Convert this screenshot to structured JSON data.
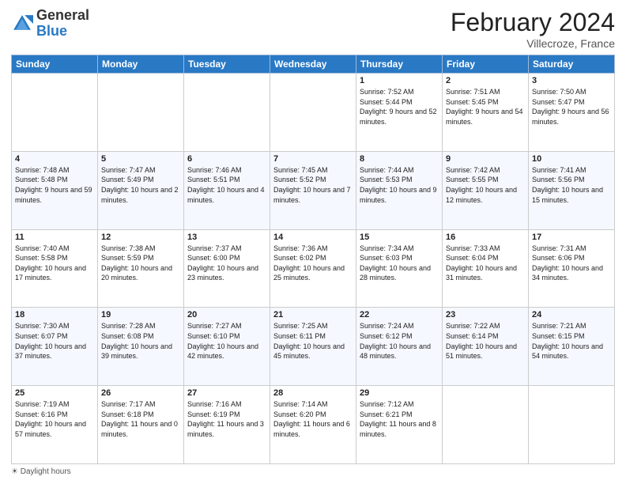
{
  "logo": {
    "general": "General",
    "blue": "Blue"
  },
  "header": {
    "title": "February 2024",
    "subtitle": "Villecroze, France"
  },
  "days": [
    "Sunday",
    "Monday",
    "Tuesday",
    "Wednesday",
    "Thursday",
    "Friday",
    "Saturday"
  ],
  "weeks": [
    [
      {
        "day": "",
        "info": ""
      },
      {
        "day": "",
        "info": ""
      },
      {
        "day": "",
        "info": ""
      },
      {
        "day": "",
        "info": ""
      },
      {
        "day": "1",
        "info": "Sunrise: 7:52 AM\nSunset: 5:44 PM\nDaylight: 9 hours and 52 minutes."
      },
      {
        "day": "2",
        "info": "Sunrise: 7:51 AM\nSunset: 5:45 PM\nDaylight: 9 hours and 54 minutes."
      },
      {
        "day": "3",
        "info": "Sunrise: 7:50 AM\nSunset: 5:47 PM\nDaylight: 9 hours and 56 minutes."
      }
    ],
    [
      {
        "day": "4",
        "info": "Sunrise: 7:48 AM\nSunset: 5:48 PM\nDaylight: 9 hours and 59 minutes."
      },
      {
        "day": "5",
        "info": "Sunrise: 7:47 AM\nSunset: 5:49 PM\nDaylight: 10 hours and 2 minutes."
      },
      {
        "day": "6",
        "info": "Sunrise: 7:46 AM\nSunset: 5:51 PM\nDaylight: 10 hours and 4 minutes."
      },
      {
        "day": "7",
        "info": "Sunrise: 7:45 AM\nSunset: 5:52 PM\nDaylight: 10 hours and 7 minutes."
      },
      {
        "day": "8",
        "info": "Sunrise: 7:44 AM\nSunset: 5:53 PM\nDaylight: 10 hours and 9 minutes."
      },
      {
        "day": "9",
        "info": "Sunrise: 7:42 AM\nSunset: 5:55 PM\nDaylight: 10 hours and 12 minutes."
      },
      {
        "day": "10",
        "info": "Sunrise: 7:41 AM\nSunset: 5:56 PM\nDaylight: 10 hours and 15 minutes."
      }
    ],
    [
      {
        "day": "11",
        "info": "Sunrise: 7:40 AM\nSunset: 5:58 PM\nDaylight: 10 hours and 17 minutes."
      },
      {
        "day": "12",
        "info": "Sunrise: 7:38 AM\nSunset: 5:59 PM\nDaylight: 10 hours and 20 minutes."
      },
      {
        "day": "13",
        "info": "Sunrise: 7:37 AM\nSunset: 6:00 PM\nDaylight: 10 hours and 23 minutes."
      },
      {
        "day": "14",
        "info": "Sunrise: 7:36 AM\nSunset: 6:02 PM\nDaylight: 10 hours and 25 minutes."
      },
      {
        "day": "15",
        "info": "Sunrise: 7:34 AM\nSunset: 6:03 PM\nDaylight: 10 hours and 28 minutes."
      },
      {
        "day": "16",
        "info": "Sunrise: 7:33 AM\nSunset: 6:04 PM\nDaylight: 10 hours and 31 minutes."
      },
      {
        "day": "17",
        "info": "Sunrise: 7:31 AM\nSunset: 6:06 PM\nDaylight: 10 hours and 34 minutes."
      }
    ],
    [
      {
        "day": "18",
        "info": "Sunrise: 7:30 AM\nSunset: 6:07 PM\nDaylight: 10 hours and 37 minutes."
      },
      {
        "day": "19",
        "info": "Sunrise: 7:28 AM\nSunset: 6:08 PM\nDaylight: 10 hours and 39 minutes."
      },
      {
        "day": "20",
        "info": "Sunrise: 7:27 AM\nSunset: 6:10 PM\nDaylight: 10 hours and 42 minutes."
      },
      {
        "day": "21",
        "info": "Sunrise: 7:25 AM\nSunset: 6:11 PM\nDaylight: 10 hours and 45 minutes."
      },
      {
        "day": "22",
        "info": "Sunrise: 7:24 AM\nSunset: 6:12 PM\nDaylight: 10 hours and 48 minutes."
      },
      {
        "day": "23",
        "info": "Sunrise: 7:22 AM\nSunset: 6:14 PM\nDaylight: 10 hours and 51 minutes."
      },
      {
        "day": "24",
        "info": "Sunrise: 7:21 AM\nSunset: 6:15 PM\nDaylight: 10 hours and 54 minutes."
      }
    ],
    [
      {
        "day": "25",
        "info": "Sunrise: 7:19 AM\nSunset: 6:16 PM\nDaylight: 10 hours and 57 minutes."
      },
      {
        "day": "26",
        "info": "Sunrise: 7:17 AM\nSunset: 6:18 PM\nDaylight: 11 hours and 0 minutes."
      },
      {
        "day": "27",
        "info": "Sunrise: 7:16 AM\nSunset: 6:19 PM\nDaylight: 11 hours and 3 minutes."
      },
      {
        "day": "28",
        "info": "Sunrise: 7:14 AM\nSunset: 6:20 PM\nDaylight: 11 hours and 6 minutes."
      },
      {
        "day": "29",
        "info": "Sunrise: 7:12 AM\nSunset: 6:21 PM\nDaylight: 11 hours and 8 minutes."
      },
      {
        "day": "",
        "info": ""
      },
      {
        "day": "",
        "info": ""
      }
    ]
  ],
  "footer": {
    "daylight_label": "Daylight hours"
  }
}
